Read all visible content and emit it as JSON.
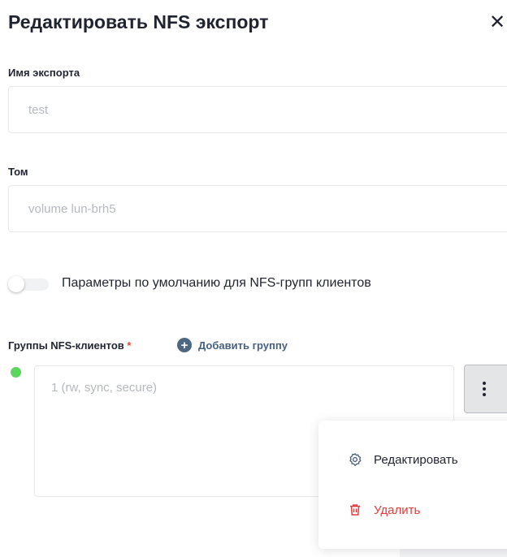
{
  "dialog": {
    "title": "Редактировать NFS экспорт",
    "close_label": "✕"
  },
  "export_name": {
    "label": "Имя экспорта",
    "value": "test"
  },
  "volume": {
    "label": "Том",
    "value": "volume lun-brh5"
  },
  "defaults_toggle": {
    "label": "Параметры по умолчанию для NFS-групп клиентов",
    "checked": false
  },
  "client_groups": {
    "label": "Группы NFS-клиентов",
    "required_mark": "*",
    "add_button_label": "Добавить группу",
    "groups": [
      {
        "text": "1 (rw, sync, secure)",
        "status_color": "#5cd65f"
      }
    ]
  },
  "context_menu": {
    "edit_label": "Редактировать",
    "delete_label": "Удалить"
  },
  "colors": {
    "accent": "#4d6783",
    "danger": "#e23b3b",
    "status_ok": "#5cd65f"
  },
  "icons": {
    "close": "close-icon",
    "add": "plus-circle-icon",
    "more": "kebab-icon",
    "edit": "gear-icon",
    "delete": "trash-icon"
  }
}
